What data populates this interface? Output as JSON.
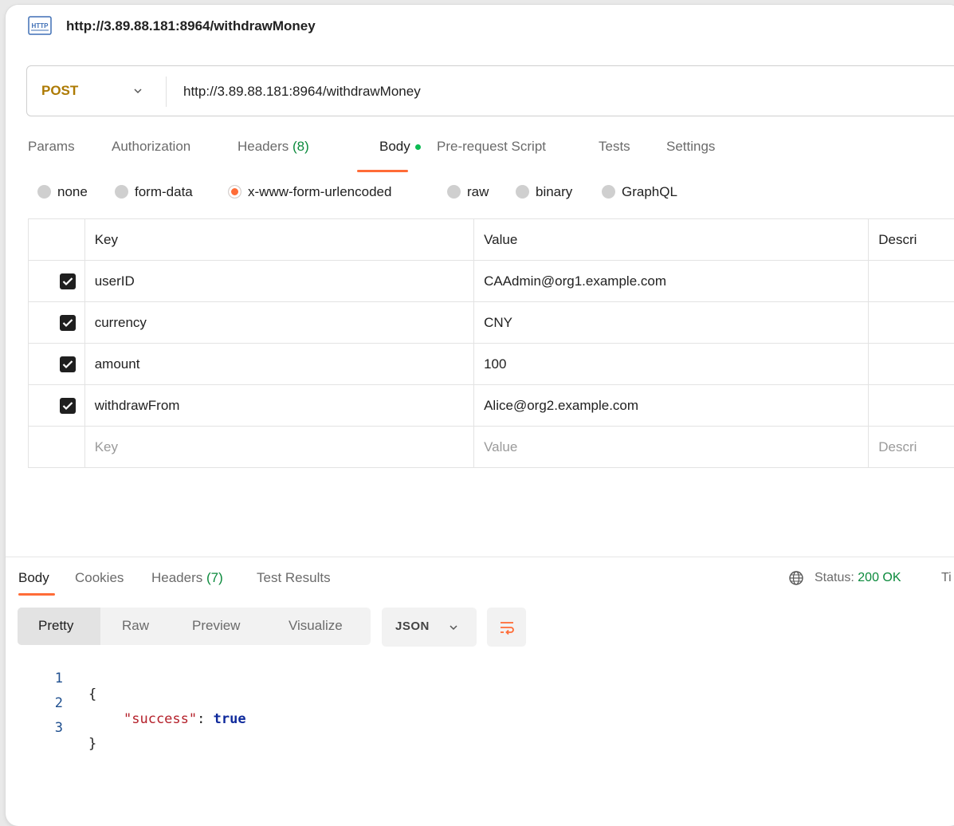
{
  "title": {
    "icon": "http-icon",
    "text": "http://3.89.88.181:8964/withdrawMoney"
  },
  "request": {
    "method": "POST",
    "url": "http://3.89.88.181:8964/withdrawMoney"
  },
  "request_tabs": [
    {
      "label": "Params"
    },
    {
      "label": "Authorization"
    },
    {
      "label": "Headers",
      "count": "(8)"
    },
    {
      "label": "Body",
      "active": true
    },
    {
      "label": "Pre-request Script"
    },
    {
      "label": "Tests"
    },
    {
      "label": "Settings"
    }
  ],
  "body_types": [
    {
      "label": "none"
    },
    {
      "label": "form-data"
    },
    {
      "label": "x-www-form-urlencoded",
      "selected": true
    },
    {
      "label": "raw"
    },
    {
      "label": "binary"
    },
    {
      "label": "GraphQL"
    }
  ],
  "table": {
    "headers": {
      "key": "Key",
      "value": "Value",
      "description": "Descri"
    },
    "rows": [
      {
        "checked": true,
        "key": "userID",
        "value": "CAAdmin@org1.example.com"
      },
      {
        "checked": true,
        "key": "currency",
        "value": "CNY"
      },
      {
        "checked": true,
        "key": "amount",
        "value": "100"
      },
      {
        "checked": true,
        "key": "withdrawFrom",
        "value": "Alice@org2.example.com"
      }
    ],
    "placeholder": {
      "key": "Key",
      "value": "Value",
      "description": "Descri"
    }
  },
  "response": {
    "tabs": [
      {
        "label": "Body",
        "active": true
      },
      {
        "label": "Cookies"
      },
      {
        "label": "Headers",
        "count": "(7)"
      },
      {
        "label": "Test Results"
      }
    ],
    "status_label": "Status:",
    "status_value": "200 OK",
    "status_trunc": "Ti",
    "view_modes": [
      "Pretty",
      "Raw",
      "Preview",
      "Visualize"
    ],
    "active_view": "Pretty",
    "format": "JSON",
    "code_lines": [
      {
        "n": "1",
        "text": "{"
      },
      {
        "n": "2",
        "key": "\"success\"",
        "colon": ": ",
        "val": "true"
      },
      {
        "n": "3",
        "text": "}"
      }
    ]
  },
  "colors": {
    "accent": "#ff6c37",
    "method": "#ad7a03",
    "success": "#0b8a3c"
  }
}
